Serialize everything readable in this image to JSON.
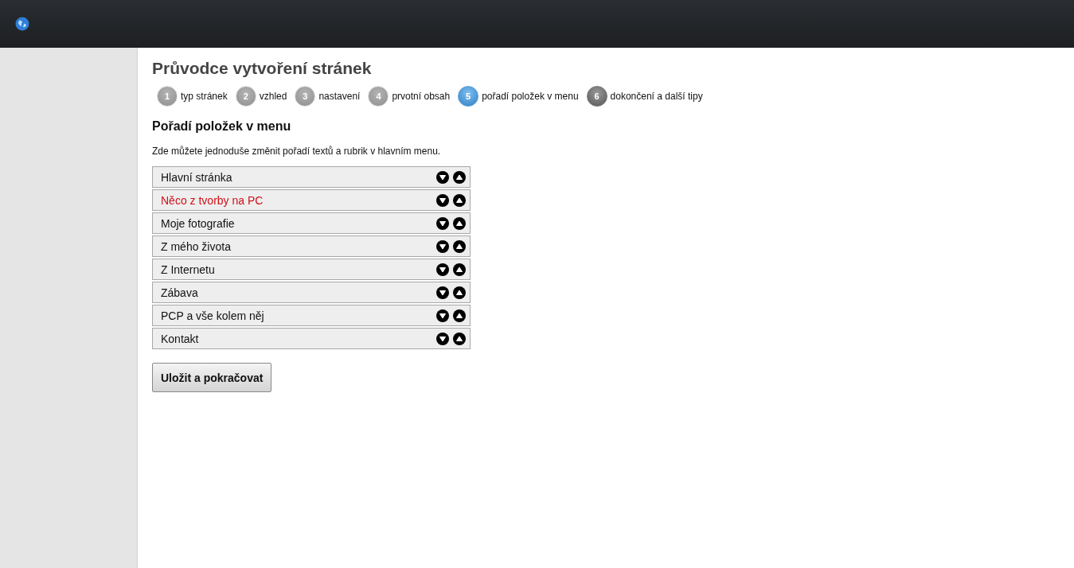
{
  "title": "Průvodce vytvoření stránek",
  "steps": [
    {
      "number": "1",
      "label": "typ stránek",
      "completed": true,
      "selected": false
    },
    {
      "number": "2",
      "label": "vzhled",
      "completed": true,
      "selected": false
    },
    {
      "number": "3",
      "label": "nastavení",
      "completed": true,
      "selected": false
    },
    {
      "number": "4",
      "label": "prvotní obsah",
      "completed": true,
      "selected": false
    },
    {
      "number": "5",
      "label": "pořadí položek v menu",
      "completed": false,
      "selected": true
    },
    {
      "number": "6",
      "label": "dokončení a další tipy",
      "completed": false,
      "selected": false
    }
  ],
  "heading": "Pořadí položek v menu",
  "description": "Zde můžete jednoduše změnit pořadí textů a rubrik v hlavním menu.",
  "menu_items": [
    {
      "label": "Hlavní stránka",
      "highlighted": false
    },
    {
      "label": "Něco z tvorby na PC",
      "highlighted": true
    },
    {
      "label": "Moje fotografie",
      "highlighted": false
    },
    {
      "label": "Z mého života",
      "highlighted": false
    },
    {
      "label": "Z Internetu",
      "highlighted": false
    },
    {
      "label": "Zábava",
      "highlighted": false
    },
    {
      "label": "PCP a vše kolem něj",
      "highlighted": false
    },
    {
      "label": "Kontakt",
      "highlighted": false
    }
  ],
  "submit_button": "Uložit a pokračovat"
}
